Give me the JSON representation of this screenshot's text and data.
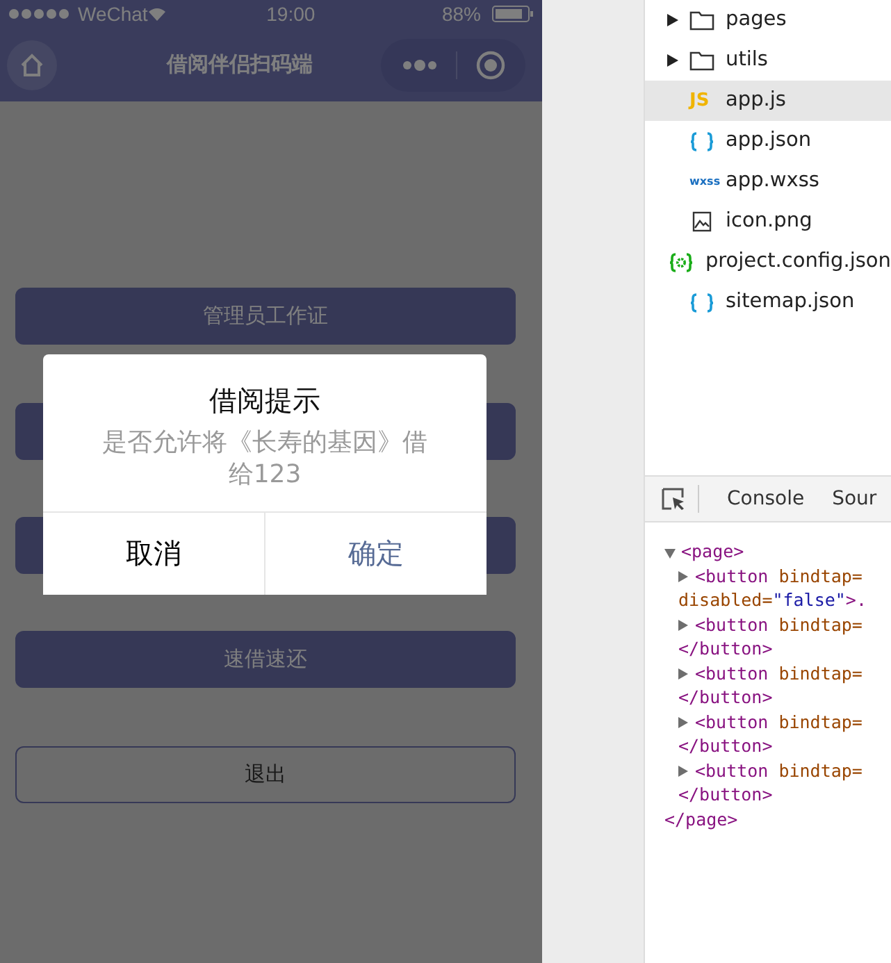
{
  "status_bar": {
    "carrier": "WeChat",
    "time": "19:00",
    "battery": "88%"
  },
  "nav_bar": {
    "title": "借阅伴侣扫码端"
  },
  "buttons": [
    {
      "kind": "filled",
      "label": "管理员工作证"
    },
    {
      "kind": "filled"
    },
    {
      "kind": "filled"
    },
    {
      "kind": "filled",
      "label": "速借速还"
    },
    {
      "kind": "outline",
      "label": "退出"
    }
  ],
  "modal": {
    "title": "借阅提示",
    "content": "是否允许将《长寿的基因》借给123",
    "cancel": "取消",
    "confirm": "确定"
  },
  "file_tree": [
    {
      "name": "pages",
      "kind": "folder",
      "expanded": false,
      "selected": false
    },
    {
      "name": "utils",
      "kind": "folder",
      "expanded": false,
      "selected": false
    },
    {
      "name": "app.js",
      "kind": "js",
      "icon_text": "JS",
      "selected": true
    },
    {
      "name": "app.json",
      "kind": "json",
      "selected": false
    },
    {
      "name": "app.wxss",
      "kind": "wxss",
      "icon_text": "wxss",
      "selected": false
    },
    {
      "name": "icon.png",
      "kind": "image",
      "selected": false
    },
    {
      "name": "project.config.json",
      "kind": "config",
      "selected": false
    },
    {
      "name": "sitemap.json",
      "kind": "json",
      "selected": false
    }
  ],
  "devtools": {
    "tabs": [
      {
        "label": "Console"
      },
      {
        "label": "Sour"
      }
    ],
    "elements": {
      "open": "<page>",
      "expanded": true,
      "close": "</page>",
      "children": [
        {
          "open": "<button",
          "attr": "bindtap=",
          "expanded": false,
          "tail": [
            {
              "kind": "attr",
              "text": "disabled="
            },
            {
              "kind": "value",
              "text": "\"false\""
            },
            {
              "kind": "tag",
              "text": ">."
            }
          ]
        },
        {
          "open": "<button",
          "attr": "bindtap=",
          "expanded": false,
          "tail": [
            {
              "kind": "tag",
              "text": "</button>"
            }
          ]
        },
        {
          "open": "<button",
          "attr": "bindtap=",
          "expanded": false,
          "tail": [
            {
              "kind": "tag",
              "text": "</button>"
            }
          ]
        },
        {
          "open": "<button",
          "attr": "bindtap=",
          "expanded": false,
          "tail": [
            {
              "kind": "tag",
              "text": "</button>"
            }
          ]
        },
        {
          "open": "<button",
          "attr": "bindtap=",
          "expanded": false,
          "tail": [
            {
              "kind": "tag",
              "text": "</button>"
            }
          ]
        }
      ]
    }
  }
}
